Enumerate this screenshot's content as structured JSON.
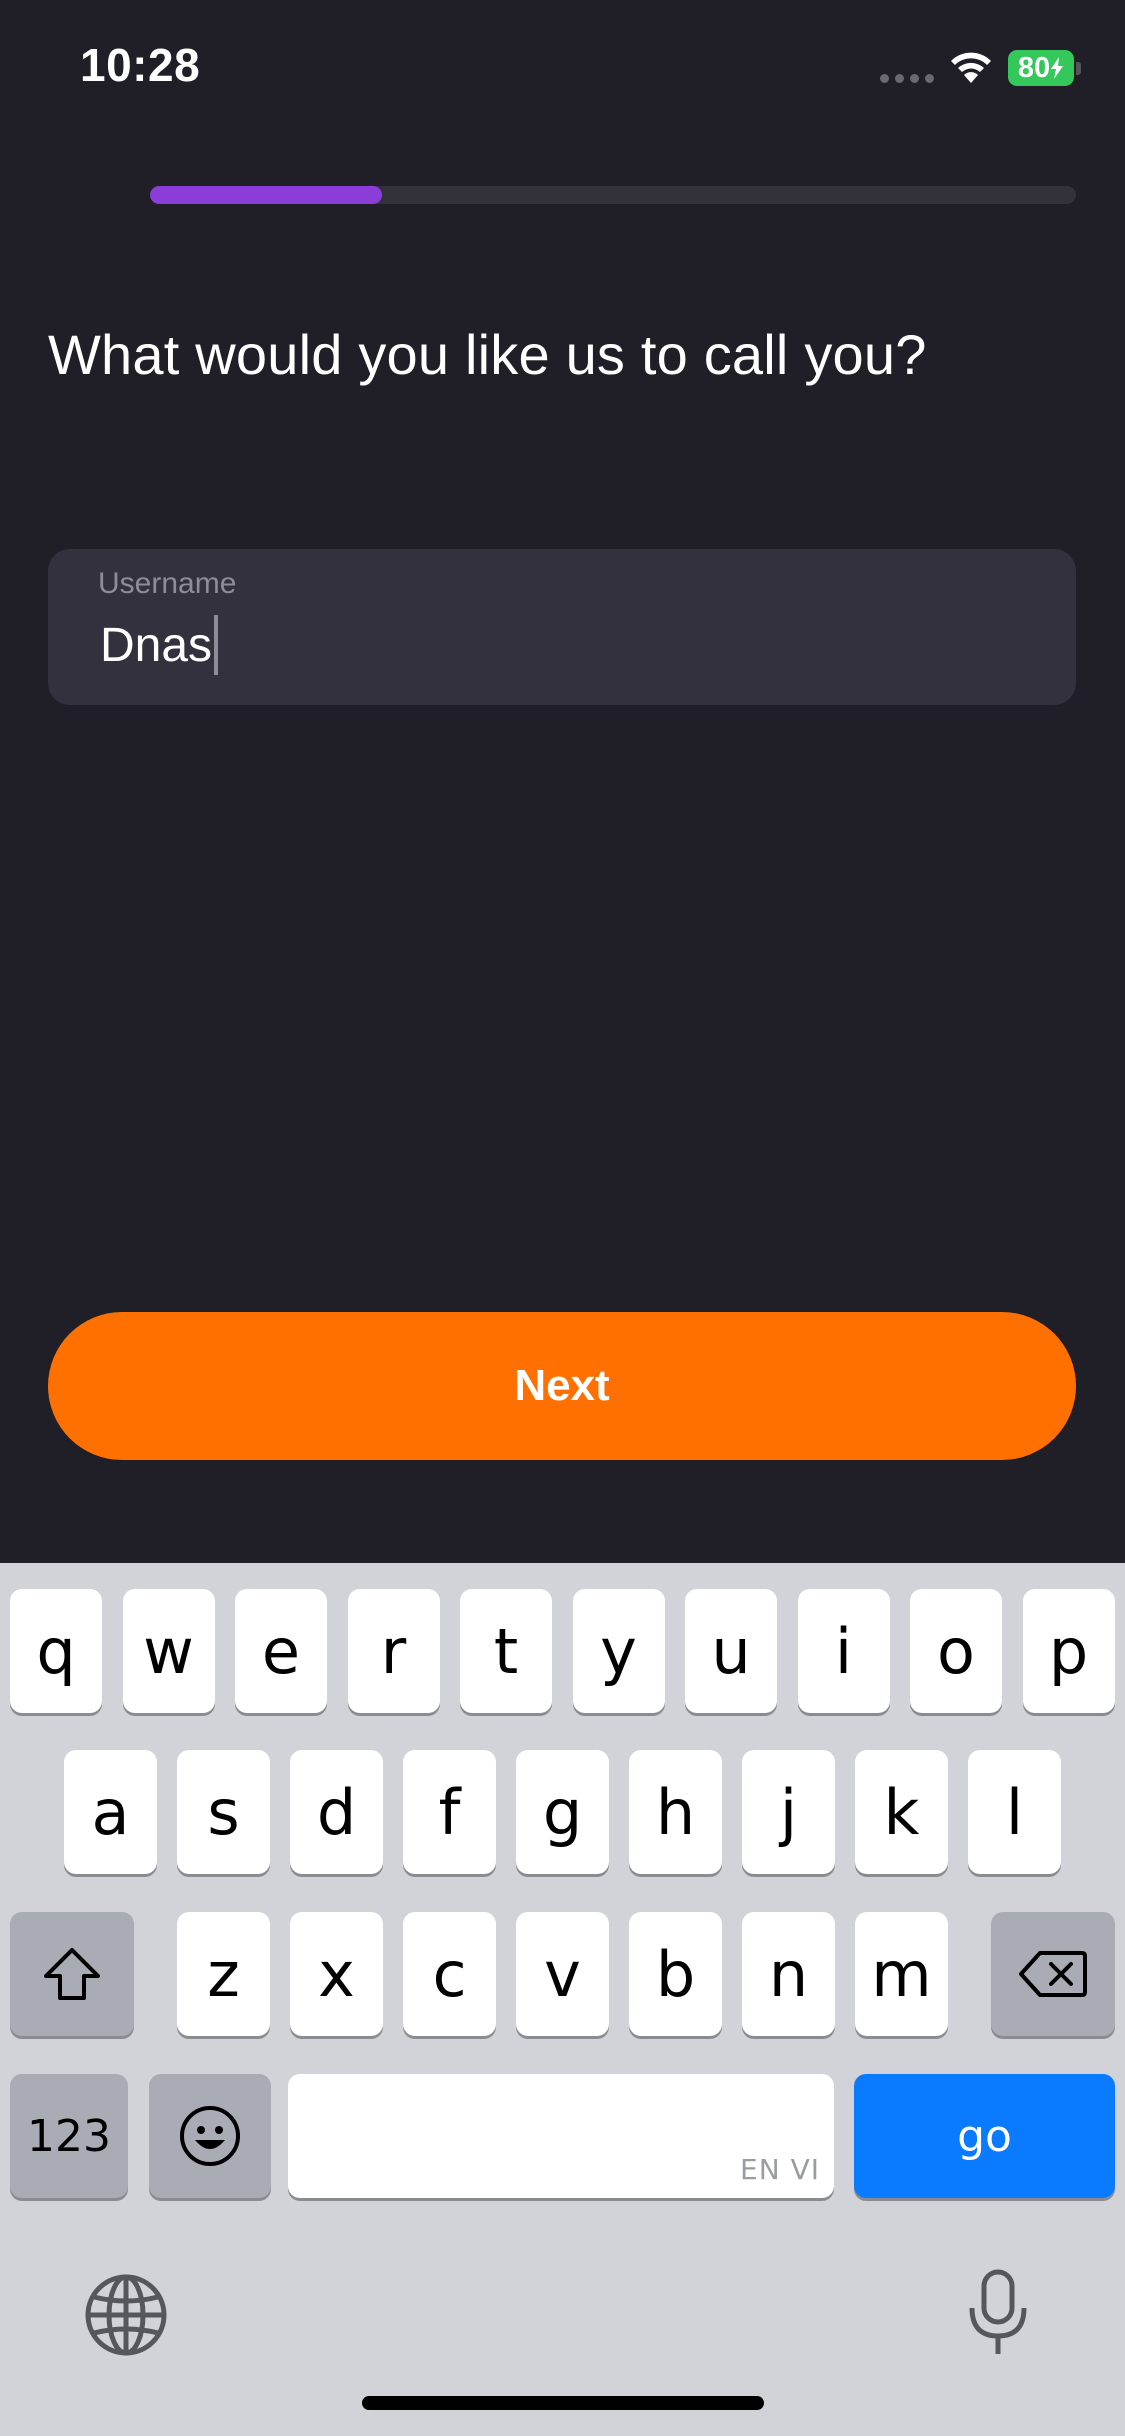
{
  "status_bar": {
    "time": "10:28",
    "battery_level": "80"
  },
  "progress": {
    "fraction": 0.25
  },
  "title": "What would you like us to call you?",
  "username_field": {
    "label": "Username",
    "value": "Dnas"
  },
  "next_button": {
    "label": "Next"
  },
  "keyboard": {
    "row1": [
      "q",
      "w",
      "e",
      "r",
      "t",
      "y",
      "u",
      "i",
      "o",
      "p"
    ],
    "row2": [
      "a",
      "s",
      "d",
      "f",
      "g",
      "h",
      "j",
      "k",
      "l"
    ],
    "row3": [
      "z",
      "x",
      "c",
      "v",
      "b",
      "n",
      "m"
    ],
    "numbers_key": "123",
    "space_language": "EN VI",
    "go_key": "go"
  },
  "colors": {
    "background": "#201e26",
    "accent_progress": "#8b3dd8",
    "button": "#ff7000",
    "go_key": "#0a7aff",
    "battery": "#34c759"
  }
}
